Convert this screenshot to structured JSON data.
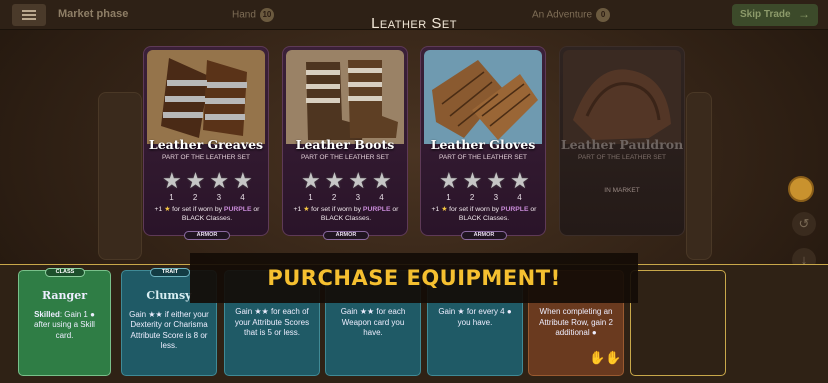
{
  "topbar": {
    "phase_label": "Market phase",
    "stat_hand": "Hand",
    "stat_hand_count": "10",
    "stat_adventure": "An Adventure",
    "stat_adventure_count": "0",
    "end_button": "Skip Trade",
    "end_arrow": "→"
  },
  "set_title": "Leather Set",
  "equipment": [
    {
      "name": "Leather Greaves",
      "subtitle": "Part of the leather set",
      "stars": [
        "★",
        "★",
        "★",
        "★"
      ],
      "star_levels": [
        "1",
        "2",
        "3",
        "4"
      ],
      "bonus_pre": "+1",
      "bonus_star": "★",
      "bonus_mid": " for set if worn by ",
      "bonus_color1": "PURPLE",
      "bonus_or": " or ",
      "bonus_color2": "BLACK",
      "bonus_post": " Classes.",
      "tag": "ARMOR"
    },
    {
      "name": "Leather Boots",
      "subtitle": "Part of the leather set",
      "stars": [
        "★",
        "★",
        "★",
        "★"
      ],
      "star_levels": [
        "1",
        "2",
        "3",
        "4"
      ],
      "bonus_pre": "+1",
      "bonus_star": "★",
      "bonus_mid": " for set if worn by ",
      "bonus_color1": "PURPLE",
      "bonus_or": " or ",
      "bonus_color2": "BLACK",
      "bonus_post": " Classes.",
      "tag": "ARMOR"
    },
    {
      "name": "Leather Gloves",
      "subtitle": "Part of the leather set",
      "stars": [
        "★",
        "★",
        "★",
        "★"
      ],
      "star_levels": [
        "1",
        "2",
        "3",
        "4"
      ],
      "bonus_pre": "+1",
      "bonus_star": "★",
      "bonus_mid": " for set if worn by ",
      "bonus_color1": "PURPLE",
      "bonus_or": " or ",
      "bonus_color2": "BLACK",
      "bonus_post": " Classes.",
      "tag": "ARMOR"
    },
    {
      "name": "Leather Pauldron",
      "subtitle": "Part of the leather set",
      "status": "In market"
    }
  ],
  "banner": "PURCHASE EQUIPMENT!",
  "bottom_cards": {
    "class_tag": "CLASS",
    "class_name": "Ranger",
    "class_text_bold": "Skilled",
    "class_text": ": Gain 1 ● after using a Skill card.",
    "trait_tag": "TRAIT",
    "trait_name": "Clumsy",
    "trait_text": "Gain ★★ if either your Dexterity or Charisma Attribute Score is 8 or less.",
    "card1_text": "Gain ★★ for each of your Attribute Scores that is 5 or less.",
    "card2_text": "Gain ★★ for each Weapon card you have.",
    "card3_text": "Gain ★ for every 4 ● you have.",
    "card4_text": "When completing an Attribute Row, gain 2 additional ●",
    "card4_icon": "✋✋"
  },
  "colors": {
    "purple": "#c88ad8",
    "gold": "#f5c030",
    "class_green": "#2f7d45",
    "skill_teal": "#1f5a66"
  },
  "icons": [
    "menu-icon",
    "arrow-right-icon",
    "star-icon",
    "coin-icon",
    "hands-icon",
    "undo-icon",
    "down-arrow-icon"
  ]
}
